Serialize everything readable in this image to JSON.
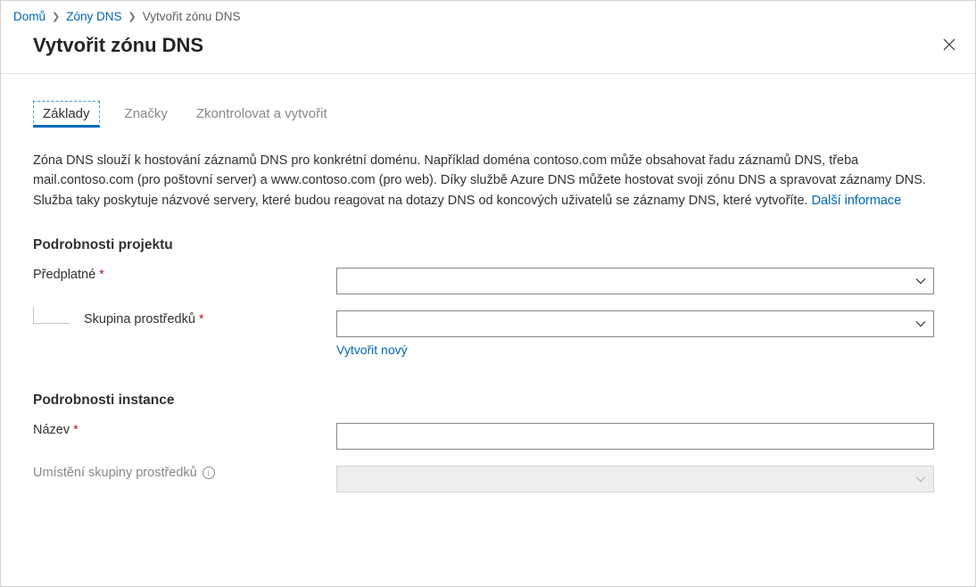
{
  "breadcrumb": {
    "home": "Domů",
    "zones": "Zóny DNS",
    "current": "Vytvořit zónu DNS"
  },
  "title": "Vytvořit zónu DNS",
  "tabs": {
    "basics": "Základy",
    "tags": "Značky",
    "review": "Zkontrolovat a vytvořit"
  },
  "description": {
    "text": "Zóna DNS slouží k hostování záznamů DNS pro konkrétní doménu. Například doména contoso.com může obsahovat řadu záznamů DNS, třeba mail.contoso.com (pro poštovní server) a www.contoso.com (pro web). Díky službě Azure DNS můžete hostovat svoji zónu DNS a spravovat záznamy DNS. Služba taky poskytuje názvové servery, které budou reagovat na dotazy DNS od koncových uživatelů se záznamy DNS, které vytvoříte. ",
    "link": "Další informace"
  },
  "sections": {
    "project": "Podrobnosti projektu",
    "instance": "Podrobnosti instance"
  },
  "fields": {
    "subscription": {
      "label": "Předplatné"
    },
    "resourceGroup": {
      "label": "Skupina prostředků",
      "createNew": "Vytvořit nový"
    },
    "name": {
      "label": "Název"
    },
    "rgLocation": {
      "label": "Umístění skupiny prostředků"
    }
  }
}
